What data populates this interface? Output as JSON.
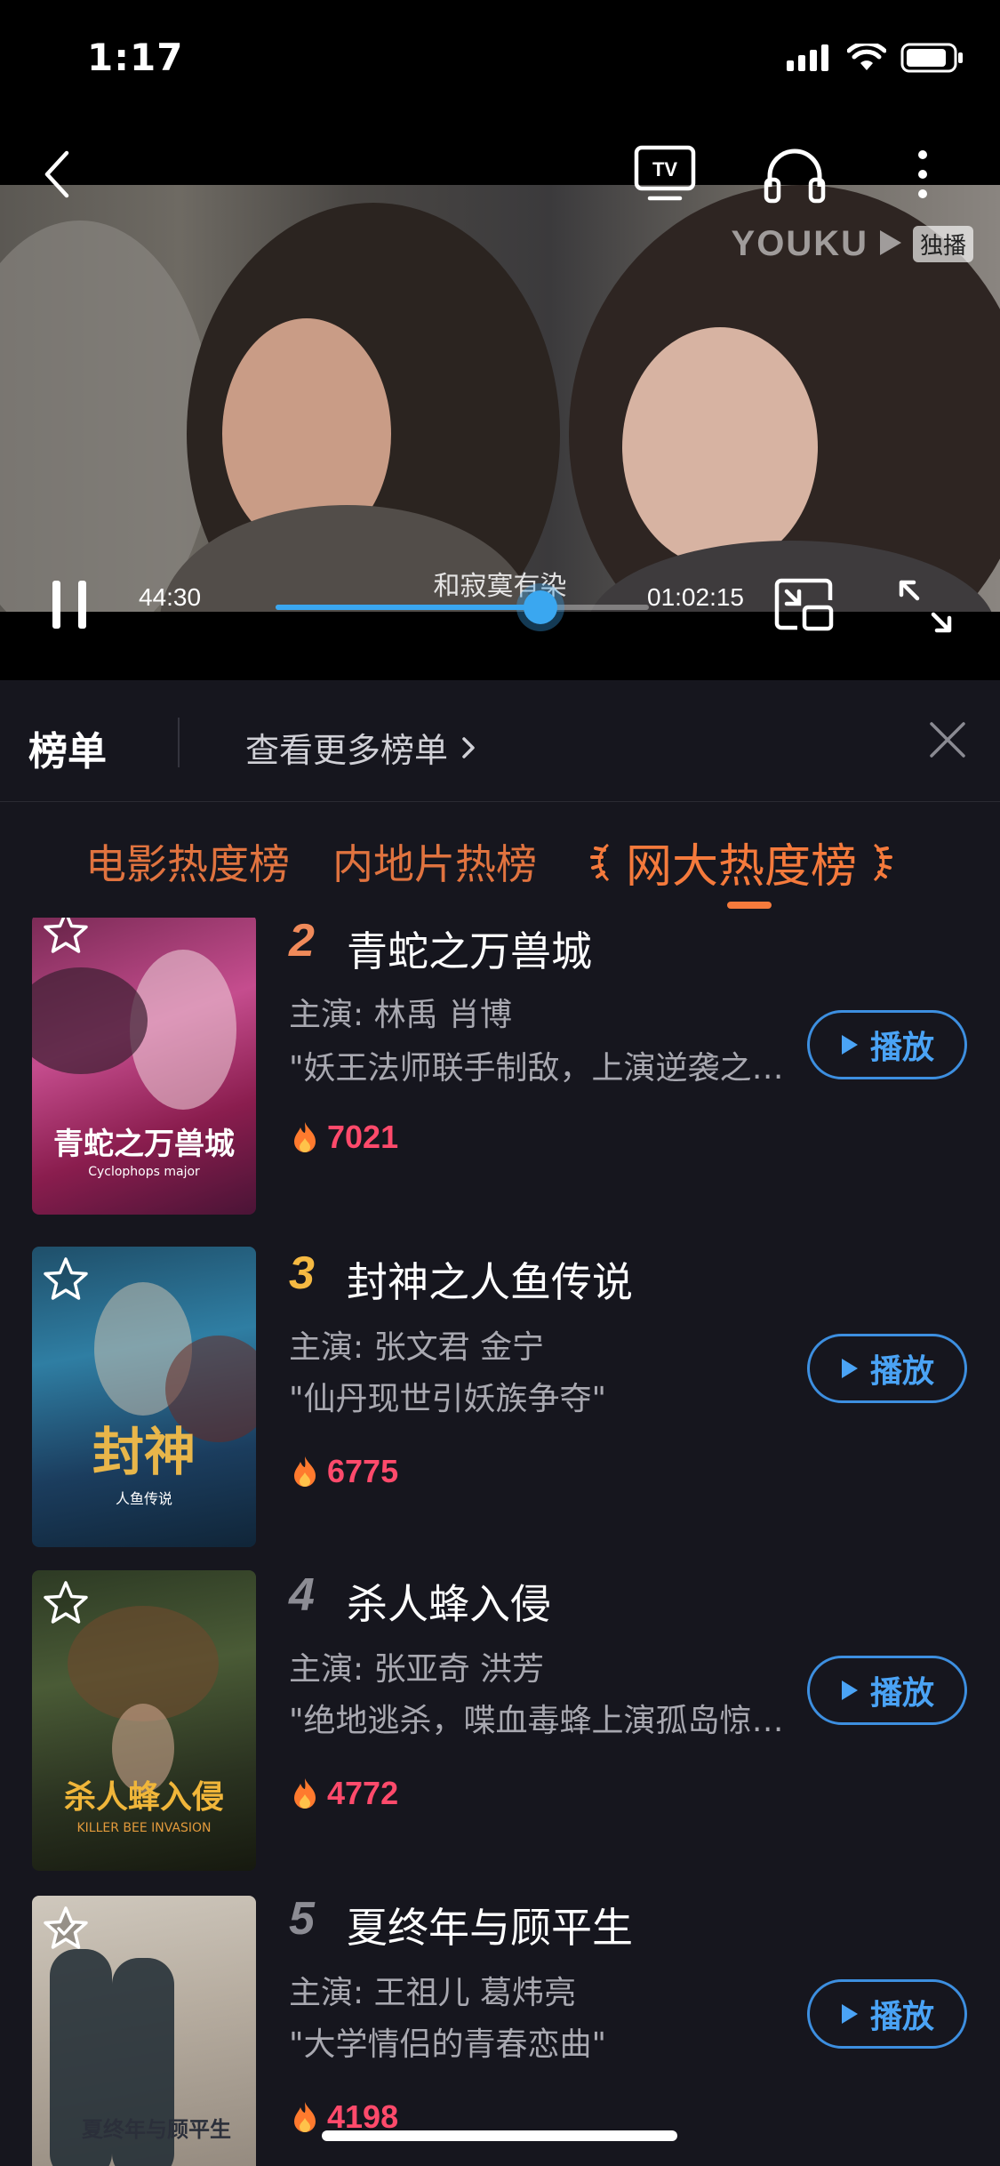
{
  "status_bar": {
    "time": "1:17"
  },
  "player": {
    "watermark_logo": "YOUKU",
    "watermark_badge": "独播",
    "subtitle": "和寂寞有染",
    "current_time": "44:30",
    "total_time": "01:02:15",
    "progress": 0.71,
    "tv_label": "TV"
  },
  "ranking": {
    "title": "榜单",
    "more_link": "查看更多榜单"
  },
  "tabs": [
    {
      "label": "电影热度榜",
      "active": false
    },
    {
      "label": "内地片热榜",
      "active": false
    },
    {
      "label": "网大热度榜",
      "active": true
    }
  ],
  "items": [
    {
      "rank": "2",
      "title": "青蛇之万兽城",
      "cast": "主演: 林禹 肖博",
      "desc": "\"妖王法师联手制敌，上演逆袭之战\"",
      "heat": "7021",
      "play_label": "播放",
      "poster_title": "青蛇之万兽城",
      "poster_sub": "Cyclophops major"
    },
    {
      "rank": "3",
      "title": "封神之人鱼传说",
      "cast": "主演: 张文君 金宁",
      "desc": "\"仙丹现世引妖族争夺\"",
      "heat": "6775",
      "play_label": "播放",
      "poster_title": "封神",
      "poster_sub": "人鱼传说"
    },
    {
      "rank": "4",
      "title": "杀人蜂入侵",
      "cast": "主演: 张亚奇 洪芳",
      "desc": "\"绝地逃杀，喋血毒蜂上演孤岛惊魂\"",
      "heat": "4772",
      "play_label": "播放",
      "poster_title": "杀人蜂入侵",
      "poster_sub": "KILLER BEE INVASION"
    },
    {
      "rank": "5",
      "title": "夏终年与顾平生",
      "cast": "主演: 王祖儿 葛炜亮",
      "desc": "\"大学情侣的青春恋曲\"",
      "heat": "4198",
      "play_label": "播放",
      "poster_title": "夏终年与顾平生",
      "poster_sub": ""
    }
  ],
  "colors": {
    "accent_orange": "#f57a3c",
    "heat_red": "#ff4a6b",
    "play_blue": "#4aa3f5",
    "rank2": "#f08a5a",
    "rank3": "#f5b942",
    "rank_other": "#8c8c94"
  }
}
